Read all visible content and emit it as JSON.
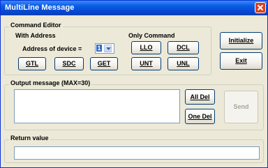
{
  "window": {
    "title": "MultiLine Message",
    "close_icon": "close-x-icon"
  },
  "command_editor": {
    "group_label": "Command Editor",
    "with_address": {
      "group_label": "With Address",
      "address_label": "Address of device =",
      "address_value": "1",
      "buttons": {
        "gtl": "GTL",
        "sdc": "SDC",
        "get": "GET"
      }
    },
    "only_command": {
      "group_label": "Only Command",
      "buttons": {
        "llo": "LLO",
        "dcl": "DCL",
        "unt": "UNT",
        "unl": "UNL"
      }
    }
  },
  "side_buttons": {
    "initialize": "Initialize",
    "exit": "Exit"
  },
  "output": {
    "group_label": "Output message (MAX=30)",
    "value": "",
    "buttons": {
      "all_del": "All Del",
      "one_del": "One Del",
      "send": "Send"
    }
  },
  "return_value": {
    "group_label": "Return value",
    "value": ""
  },
  "colors": {
    "title_bar": "#0a5ce8",
    "window_bg": "#ece9d8",
    "close_button": "#d9411e",
    "selection": "#316ac5"
  }
}
